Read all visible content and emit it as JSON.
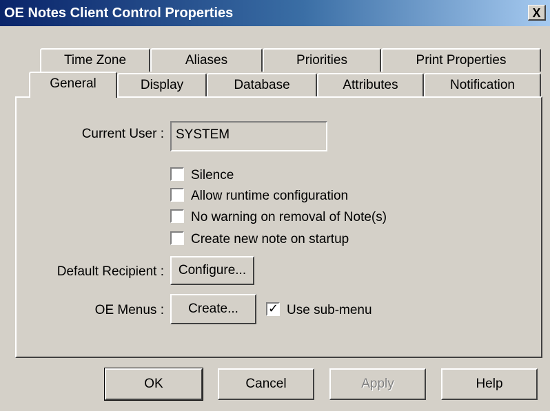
{
  "window": {
    "title": "OE Notes Client Control Properties",
    "close_glyph": "X"
  },
  "tabs": {
    "back_row": [
      "Time Zone",
      "Aliases",
      "Priorities",
      "Print Properties"
    ],
    "front_row": [
      "General",
      "Display",
      "Database",
      "Attributes",
      "Notification"
    ],
    "active": "General"
  },
  "general": {
    "current_user_label": "Current User :",
    "current_user_value": "SYSTEM",
    "checkboxes": [
      {
        "label": "Silence",
        "checked": false
      },
      {
        "label": "Allow runtime configuration",
        "checked": false
      },
      {
        "label": "No warning on removal of Note(s)",
        "checked": false
      },
      {
        "label": "Create new note on startup",
        "checked": false
      }
    ],
    "default_recipient_label": "Default Recipient :",
    "configure_button": "Configure...",
    "oe_menus_label": "OE Menus :",
    "create_button": "Create...",
    "use_submenu": {
      "label": "Use sub-menu",
      "checked": true,
      "mark": "✓"
    }
  },
  "buttons": {
    "ok": "OK",
    "cancel": "Cancel",
    "apply": "Apply",
    "help": "Help"
  }
}
